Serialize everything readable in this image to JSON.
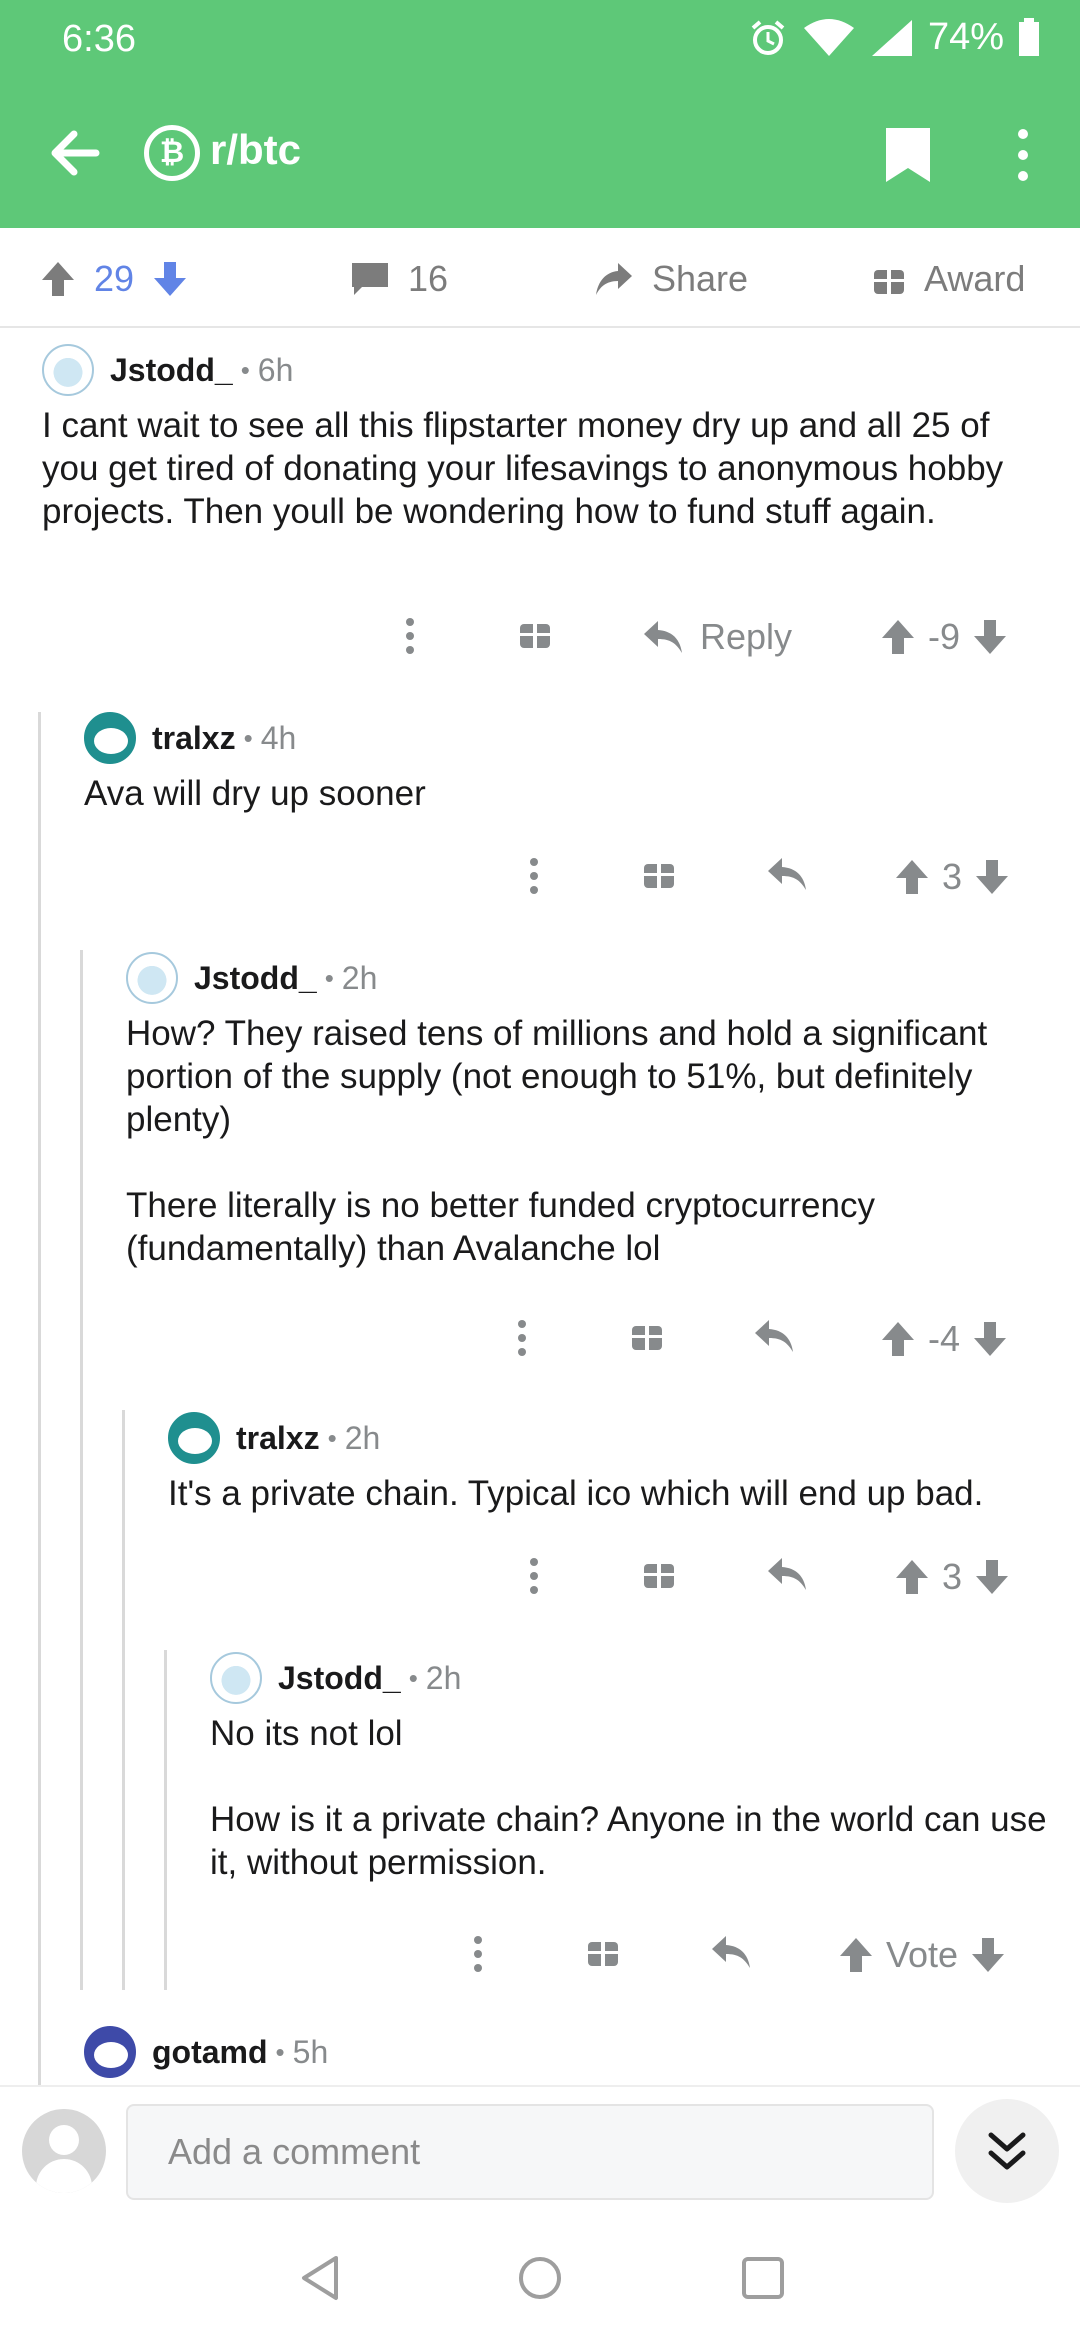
{
  "status_bar": {
    "time": "6:36",
    "battery": "74%"
  },
  "app_bar": {
    "subreddit": "r/btc",
    "sub_icon_glyph": "₿"
  },
  "post_actions": {
    "score": "29",
    "comments": "16",
    "share_label": "Share",
    "award_label": "Award"
  },
  "comments": [
    {
      "author": "Jstodd_",
      "age": "6h",
      "paragraphs": [
        "I cant wait to see all this flipstarter money dry up and all 25 of you get tired of donating your lifesavings to anonymous hobby projects. Then youll be wondering how to fund stuff again."
      ],
      "score": "-9",
      "reply_label": "Reply"
    },
    {
      "author": "tralxz",
      "age": "4h",
      "paragraphs": [
        "Ava will dry up sooner"
      ],
      "score": "3"
    },
    {
      "author": "Jstodd_",
      "age": "2h",
      "paragraphs": [
        "How? They raised tens of millions and hold a significant portion of the supply (not enough to 51%, but definitely plenty)",
        "There literally is no better funded cryptocurrency (fundamentally) than Avalanche lol"
      ],
      "score": "-4"
    },
    {
      "author": "tralxz",
      "age": "2h",
      "paragraphs": [
        "It's a private chain. Typical ico which will end up bad."
      ],
      "score": "3"
    },
    {
      "author": "Jstodd_",
      "age": "2h",
      "paragraphs": [
        "No its not lol",
        "How is it a private chain? Anyone in the world can use it, without permission."
      ],
      "score": "Vote"
    },
    {
      "author": "gotamd",
      "age": "5h"
    }
  ],
  "composer": {
    "placeholder": "Add a comment"
  },
  "colors": {
    "header": "#5ec878",
    "upvote_active": "#6184e6",
    "muted": "#878a8c"
  }
}
